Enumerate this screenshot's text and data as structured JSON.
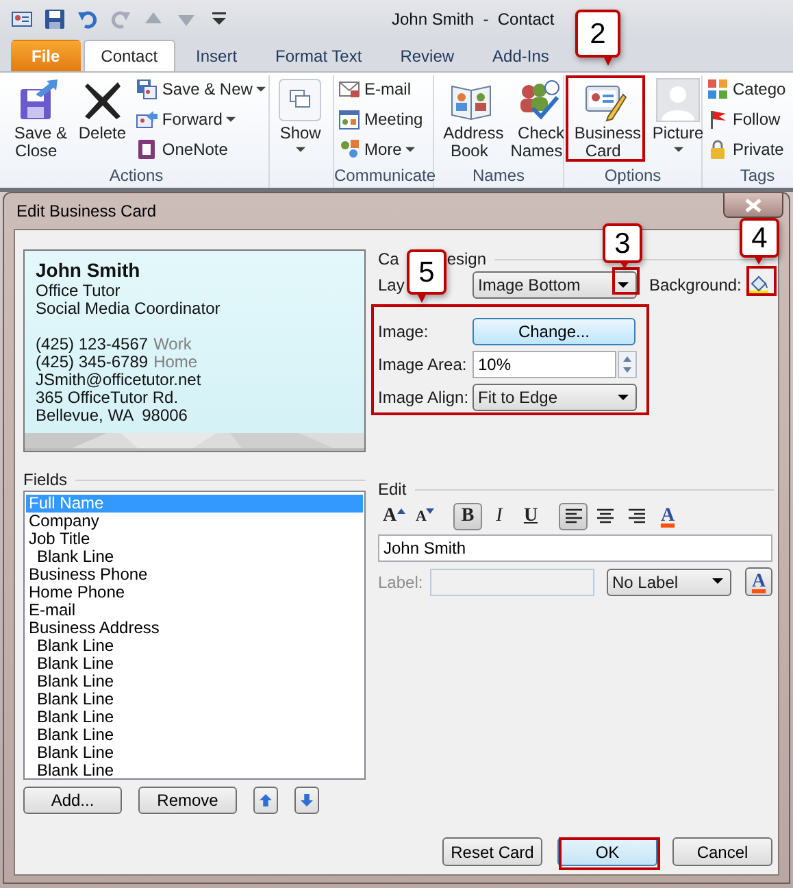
{
  "window": {
    "title": "John Smith  -  Contact"
  },
  "ribbon_tabs": [
    {
      "label": "File",
      "kind": "backstage",
      "selected": false
    },
    {
      "label": "Contact",
      "kind": "tab",
      "selected": true
    },
    {
      "label": "Insert",
      "kind": "tab",
      "selected": false
    },
    {
      "label": "Format Text",
      "kind": "tab",
      "selected": false
    },
    {
      "label": "Review",
      "kind": "tab",
      "selected": false
    },
    {
      "label": "Add-Ins",
      "kind": "tab",
      "selected": false
    }
  ],
  "ribbon_groups": [
    {
      "label": "Actions",
      "items": [
        {
          "label": "Save &\nClose",
          "kind": "large",
          "dropdown": false
        },
        {
          "label": "Delete",
          "kind": "large",
          "dropdown": false
        },
        {
          "label": "Save & New",
          "kind": "small",
          "dropdown": true
        },
        {
          "label": "Forward",
          "kind": "small",
          "dropdown": true
        },
        {
          "label": "OneNote",
          "kind": "small",
          "dropdown": false
        }
      ]
    },
    {
      "items": [
        {
          "label": "Show",
          "kind": "large",
          "dropdown": true
        }
      ]
    },
    {
      "label": "Communicate",
      "items": [
        {
          "label": "E-mail",
          "kind": "small",
          "dropdown": false
        },
        {
          "label": "Meeting",
          "kind": "small",
          "dropdown": false
        },
        {
          "label": "More",
          "kind": "small",
          "dropdown": true
        }
      ]
    },
    {
      "label": "Names",
      "items": [
        {
          "label": "Address\nBook",
          "kind": "large",
          "dropdown": false
        },
        {
          "label": "Check\nNames",
          "kind": "large",
          "dropdown": false
        }
      ]
    },
    {
      "label": "Options",
      "items": [
        {
          "label": "Business\nCard",
          "kind": "large",
          "dropdown": false
        },
        {
          "label": "Picture",
          "kind": "large",
          "dropdown": true
        }
      ]
    },
    {
      "label": "Tags",
      "items": [
        {
          "label": "Catego",
          "kind": "small",
          "dropdown": false
        },
        {
          "label": "Follow",
          "kind": "small",
          "dropdown": false
        },
        {
          "label": "Private",
          "kind": "small",
          "dropdown": false
        }
      ]
    }
  ],
  "dialog": {
    "title": "Edit Business Card",
    "card_preview": {
      "name": "John Smith",
      "lines": [
        {
          "text": "Office Tutor"
        },
        {
          "text": "Social Media Coordinator"
        }
      ],
      "contact_lines": [
        {
          "text": "(425) 123-4567",
          "label": "Work"
        },
        {
          "text": "(425) 345-6789",
          "label": "Home"
        },
        {
          "text": "JSmith@officetutor.net"
        },
        {
          "text": "365 OfficeTutor Rd."
        },
        {
          "text": "Bellevue, WA  98006"
        }
      ]
    },
    "card_design": {
      "heading_start": "Ca",
      "heading_end": "esign",
      "layout_label": "Lay",
      "layout_value": "Image Bottom",
      "background_label": "Background:",
      "image_label": "Image:",
      "image_button": "Change...",
      "image_area_label": "Image Area:",
      "image_area_value": "10%",
      "image_align_label": "Image Align:",
      "image_align_value": "Fit to Edge"
    },
    "fields": {
      "heading": "Fields",
      "items": [
        {
          "label": "Full Name",
          "selected": true
        },
        {
          "label": "Company",
          "selected": false
        },
        {
          "label": "Job Title",
          "selected": false,
          "children": [
            {
              "label": "Blank Line",
              "selected": false
            }
          ]
        },
        {
          "label": "Business Phone",
          "selected": false
        },
        {
          "label": "Home Phone",
          "selected": false
        },
        {
          "label": "E-mail",
          "selected": false
        },
        {
          "label": "Business Address",
          "selected": false,
          "children": [
            {
              "label": "Blank Line",
              "selected": false
            },
            {
              "label": "Blank Line",
              "selected": false
            },
            {
              "label": "Blank Line",
              "selected": false
            },
            {
              "label": "Blank Line",
              "selected": false
            },
            {
              "label": "Blank Line",
              "selected": false
            },
            {
              "label": "Blank Line",
              "selected": false
            },
            {
              "label": "Blank Line",
              "selected": false
            },
            {
              "label": "Blank Line",
              "selected": false
            }
          ]
        }
      ],
      "buttons": [
        "Add...",
        "Remove"
      ]
    },
    "edit": {
      "heading": "Edit",
      "format_buttons": [
        {
          "kind": "grow",
          "label": "A"
        },
        {
          "kind": "shrink",
          "label": "A"
        },
        {
          "kind": "bold",
          "label": "B",
          "on": true
        },
        {
          "kind": "italic",
          "label": "I",
          "on": false
        },
        {
          "kind": "underline",
          "label": "U",
          "on": false
        },
        {
          "kind": "align-left",
          "on": true
        },
        {
          "kind": "align-center",
          "on": false
        },
        {
          "kind": "align-right",
          "on": false
        },
        {
          "kind": "font-color",
          "label": "A"
        }
      ],
      "value": "John Smith",
      "label_caption": "Label:",
      "label_disabled": true,
      "label_position": "No Label",
      "color_button": "A"
    },
    "footer_buttons": [
      {
        "label": "Reset Card",
        "default": false
      },
      {
        "label": "OK",
        "default": true
      },
      {
        "label": "Cancel",
        "default": false
      }
    ]
  },
  "callouts": [
    {
      "number": "2"
    },
    {
      "number": "3"
    },
    {
      "number": "4"
    },
    {
      "number": "5"
    }
  ]
}
